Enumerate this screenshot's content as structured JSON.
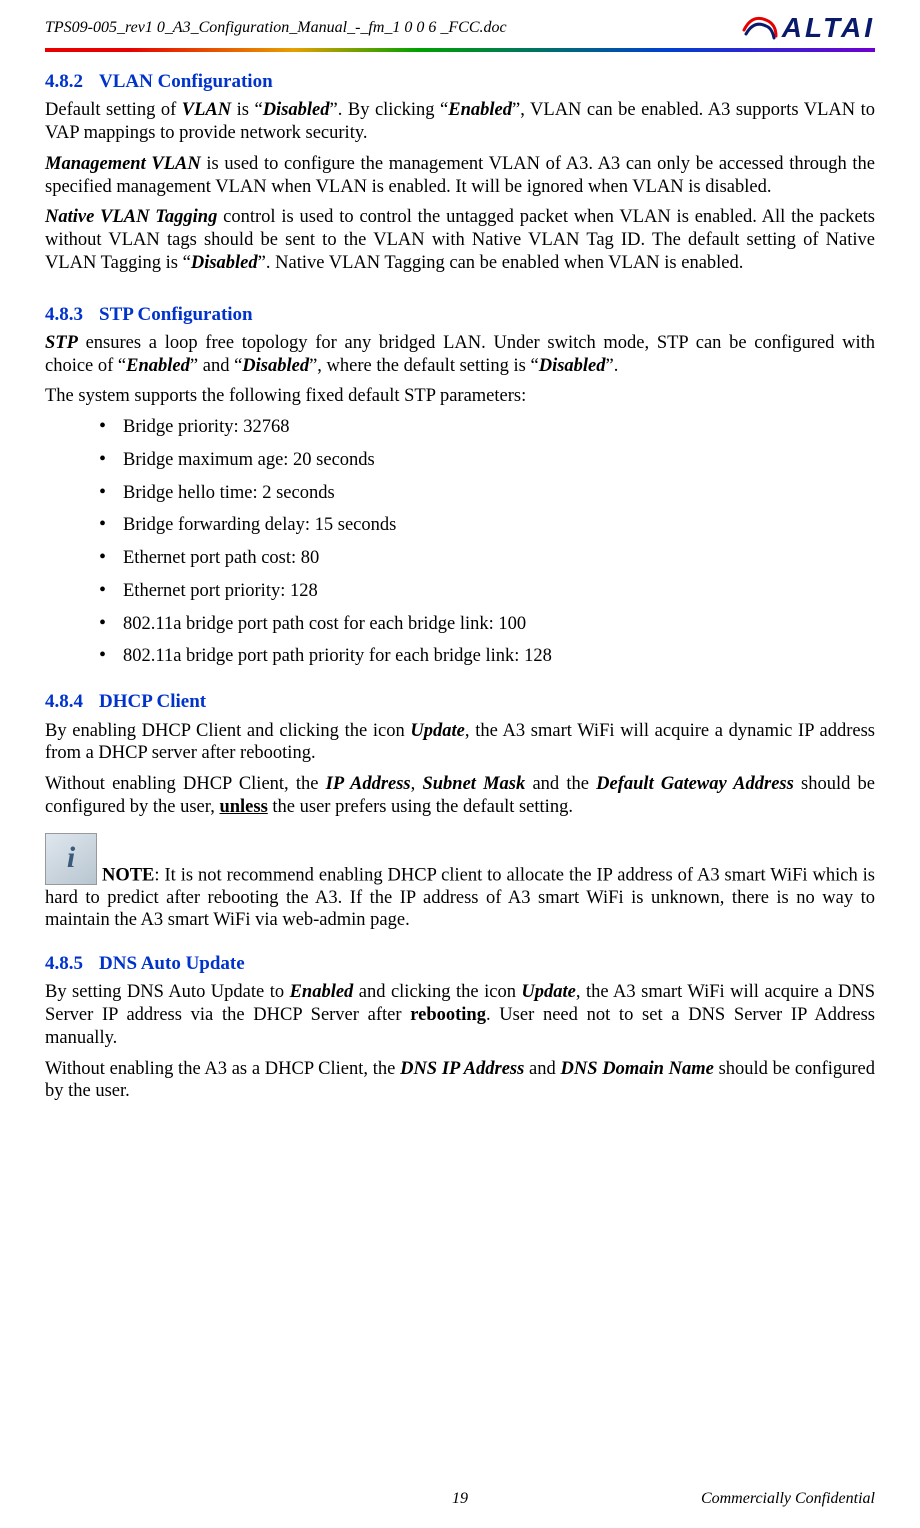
{
  "header": {
    "doc_title": "TPS09-005_rev1 0_A3_Configuration_Manual_-_fm_1 0 0 6 _FCC.doc",
    "logo_text": "ALTAI"
  },
  "s482": {
    "num": "4.8.2",
    "title": "VLAN Configuration",
    "p1_a": "Default setting of ",
    "p1_vlan": "VLAN",
    "p1_b": " is “",
    "p1_disabled": "Disabled",
    "p1_c": "”. By clicking “",
    "p1_enabled": "Enabled",
    "p1_d": "”, VLAN can be enabled. A3 supports VLAN to VAP mappings to provide network security.",
    "p2_mgmt": "Management VLAN",
    "p2_a": " is used to configure the management VLAN of A3. A3 can only be accessed through the specified management VLAN when VLAN is enabled. It will be ignored when VLAN is disabled.",
    "p3_native": "Native VLAN Tagging",
    "p3_a": " control is used to control the untagged packet when VLAN is enabled. All the packets without VLAN tags should be sent to the VLAN with Native VLAN Tag ID. The default setting of Native VLAN Tagging is “",
    "p3_disabled": "Disabled",
    "p3_b": "”. Native VLAN Tagging can be enabled when VLAN is enabled."
  },
  "s483": {
    "num": "4.8.3",
    "title": "STP Configuration",
    "p1_stp": "STP",
    "p1_a": " ensures a loop free topology for any bridged LAN. Under switch mode, STP can be configured with choice of “",
    "p1_enabled": "Enabled",
    "p1_b": "” and “",
    "p1_disabled": "Disabled",
    "p1_c": "”, where the default setting is “",
    "p1_disabled2": "Disabled",
    "p1_d": "”.",
    "p2": "The system supports the following fixed default STP parameters:",
    "items": [
      "Bridge priority: 32768",
      "Bridge maximum age: 20 seconds",
      "Bridge hello time: 2 seconds",
      "Bridge forwarding delay: 15 seconds",
      "Ethernet port path cost: 80",
      "Ethernet port priority: 128",
      "802.11a bridge port path cost for each bridge link: 100",
      "802.11a bridge port path priority for each bridge link: 128"
    ]
  },
  "s484": {
    "num": "4.8.4",
    "title": "DHCP Client",
    "p1_a": "By enabling DHCP Client and clicking the icon ",
    "p1_update": "Update",
    "p1_b": ", the A3 smart WiFi will acquire a dynamic IP address from a DHCP server after rebooting.",
    "p2_a": "Without enabling DHCP Client, the ",
    "p2_ip": "IP Address",
    "p2_b": ", ",
    "p2_mask": "Subnet Mask",
    "p2_c": " and the ",
    "p2_gw": "Default Gateway Address",
    "p2_d": " should be configured by the user, ",
    "p2_unless": "unless",
    "p2_e": " the user prefers using the default setting.",
    "note_icon": "i",
    "note_label": "NOTE",
    "note_a": ": It is not recommend enabling DHCP client to allocate the IP address of A3 smart WiFi which is hard to predict after rebooting the A3. If the IP address of A3 smart WiFi is unknown, there is no way to maintain the A3 smart WiFi via web-admin page."
  },
  "s485": {
    "num": "4.8.5",
    "title": "DNS Auto Update",
    "p1_a": "By setting DNS Auto Update to ",
    "p1_enabled": "Enabled",
    "p1_b": " and clicking the icon ",
    "p1_update": "Update",
    "p1_c": ", the A3 smart WiFi will acquire a DNS Server IP address via the DHCP Server after ",
    "p1_reboot": "rebooting",
    "p1_d": ". User need not to set a DNS Server IP Address manually.",
    "p2_a": "Without enabling the A3 as a DHCP Client, the ",
    "p2_dnsip": "DNS IP Address",
    "p2_b": " and ",
    "p2_dnsdom": "DNS Domain Name",
    "p2_c": " should be configured by the user."
  },
  "footer": {
    "page": "19",
    "right": "Commercially Confidential"
  }
}
